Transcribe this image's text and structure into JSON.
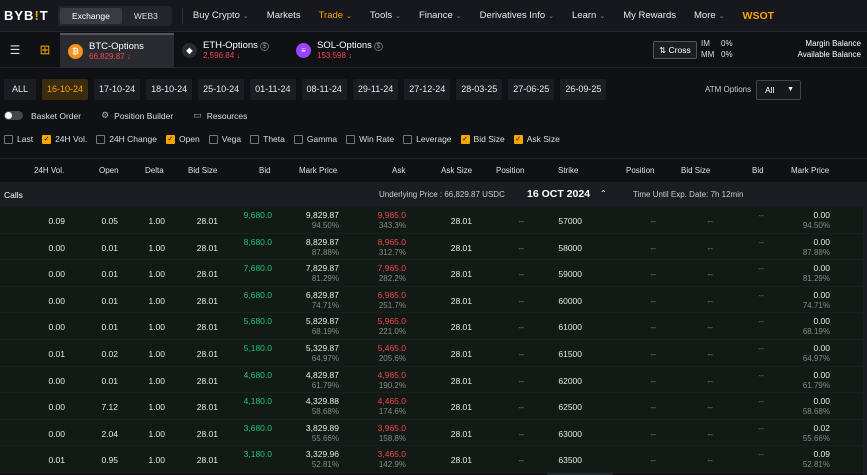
{
  "logo": {
    "text": "BYB",
    "accent": "!",
    "text2": "T"
  },
  "topnav": {
    "seg": [
      "Exchange",
      "WEB3"
    ],
    "items": [
      {
        "label": "Buy Crypto",
        "chev": true
      },
      {
        "label": "Markets",
        "chev": false
      },
      {
        "label": "Trade",
        "chev": true,
        "active": true
      },
      {
        "label": "Tools",
        "chev": true
      },
      {
        "label": "Finance",
        "chev": true
      },
      {
        "label": "Derivatives Info",
        "chev": true
      },
      {
        "label": "Learn",
        "chev": true
      },
      {
        "label": "My Rewards",
        "chev": false
      },
      {
        "label": "More",
        "chev": true
      }
    ],
    "promo": "WSOT"
  },
  "assets": [
    {
      "name": "BTC-Options",
      "price": "66,829.87 ↓",
      "color": "#f7931a",
      "glyph": "₿"
    },
    {
      "name": "ETH-Options",
      "price": "2,596.84 ↓",
      "color": "#2a2b31",
      "glyph": "◆"
    },
    {
      "name": "SOL-Options",
      "price": "153.598 ↓",
      "color": "#9945ff",
      "glyph": "≡"
    }
  ],
  "account": {
    "cross": "Cross",
    "im_label": "IM",
    "im_value": "0%",
    "mm_label": "MM",
    "mm_value": "0%",
    "margin": "Margin Balance",
    "available": "Available Balance"
  },
  "dates": {
    "all": "ALL",
    "items": [
      "16-10-24",
      "17-10-24",
      "18-10-24",
      "25-10-24",
      "01-11-24",
      "08-11-24",
      "29-11-24",
      "27-12-24",
      "28-03-25",
      "27-06-25",
      "26-09-25"
    ],
    "selected": 0
  },
  "atm": {
    "label": "ATM Options",
    "value": "All"
  },
  "tools": {
    "basket": "Basket Order",
    "builder": "Position Builder",
    "resources": "Resources"
  },
  "checks": [
    {
      "label": "Last",
      "on": false
    },
    {
      "label": "24H Vol.",
      "on": true
    },
    {
      "label": "24H Change",
      "on": false
    },
    {
      "label": "Open",
      "on": true
    },
    {
      "label": "Vega",
      "on": false
    },
    {
      "label": "Theta",
      "on": false
    },
    {
      "label": "Gamma",
      "on": false
    },
    {
      "label": "Win Rate",
      "on": false
    },
    {
      "label": "Leverage",
      "on": false
    },
    {
      "label": "Bid Size",
      "on": true
    },
    {
      "label": "Ask Size",
      "on": true
    }
  ],
  "headers": {
    "vol": "24H Vol.",
    "open": "Open",
    "delta": "Delta",
    "bidsize": "Bid Size",
    "bid": "Bid",
    "mark": "Mark Price",
    "ask": "Ask",
    "asksize": "Ask Size",
    "position": "Position",
    "strike": "Strike",
    "position2": "Position",
    "bidsize2": "Bid Size",
    "bid2": "Bid",
    "mark2": "Mark Price"
  },
  "calls": {
    "label": "Calls",
    "underlying": "Underlying Price : 66,829.87 USDC",
    "expiry": "16 OCT 2024",
    "time": "Time Until Exp. Date:  7h 12min"
  },
  "rows": [
    {
      "vol": "0.09",
      "open": "0.05",
      "delta": "1.00",
      "bidsize": "28.01",
      "bid": "9,680.0",
      "mark": "9,829.87",
      "markpct": "94.50%",
      "ask": "9,965.0",
      "askpct": "343.3%",
      "asksize": "28.01",
      "pos": "--",
      "strike": "57000",
      "pos2": "--",
      "bidsize2": "--",
      "bid2": "--",
      "mark2": "0.00",
      "mark2pct": "94.50%"
    },
    {
      "vol": "0.00",
      "open": "0.01",
      "delta": "1.00",
      "bidsize": "28.01",
      "bid": "8,680.0",
      "mark": "8,829.87",
      "markpct": "87.88%",
      "ask": "8,965.0",
      "askpct": "312.7%",
      "asksize": "28.01",
      "pos": "--",
      "strike": "58000",
      "pos2": "--",
      "bidsize2": "--",
      "bid2": "--",
      "mark2": "0.00",
      "mark2pct": "87.88%"
    },
    {
      "vol": "0.00",
      "open": "0.01",
      "delta": "1.00",
      "bidsize": "28.01",
      "bid": "7,680.0",
      "mark": "7,829.87",
      "markpct": "81.29%",
      "ask": "7,965.0",
      "askpct": "282.2%",
      "asksize": "28.01",
      "pos": "--",
      "strike": "59000",
      "pos2": "--",
      "bidsize2": "--",
      "bid2": "--",
      "mark2": "0.00",
      "mark2pct": "81.29%"
    },
    {
      "vol": "0.00",
      "open": "0.01",
      "delta": "1.00",
      "bidsize": "28.01",
      "bid": "6,680.0",
      "mark": "6,829.87",
      "markpct": "74.71%",
      "ask": "6,965.0",
      "askpct": "251.7%",
      "asksize": "28.01",
      "pos": "--",
      "strike": "60000",
      "pos2": "--",
      "bidsize2": "--",
      "bid2": "--",
      "mark2": "0.00",
      "mark2pct": "74.71%"
    },
    {
      "vol": "0.00",
      "open": "0.01",
      "delta": "1.00",
      "bidsize": "28.01",
      "bid": "5,680.0",
      "mark": "5,829.87",
      "markpct": "68.19%",
      "ask": "5,965.0",
      "askpct": "221.0%",
      "asksize": "28.01",
      "pos": "--",
      "strike": "61000",
      "pos2": "--",
      "bidsize2": "--",
      "bid2": "--",
      "mark2": "0.00",
      "mark2pct": "68.19%"
    },
    {
      "vol": "0.01",
      "open": "0.02",
      "delta": "1.00",
      "bidsize": "28.01",
      "bid": "5,180.0",
      "mark": "5,329.87",
      "markpct": "64.97%",
      "ask": "5,465.0",
      "askpct": "205.6%",
      "asksize": "28.01",
      "pos": "--",
      "strike": "61500",
      "pos2": "--",
      "bidsize2": "--",
      "bid2": "--",
      "mark2": "0.00",
      "mark2pct": "64.97%"
    },
    {
      "vol": "0.00",
      "open": "0.01",
      "delta": "1.00",
      "bidsize": "28.01",
      "bid": "4,680.0",
      "mark": "4,829.87",
      "markpct": "61.79%",
      "ask": "4,965.0",
      "askpct": "190.2%",
      "asksize": "28.01",
      "pos": "--",
      "strike": "62000",
      "pos2": "--",
      "bidsize2": "--",
      "bid2": "--",
      "mark2": "0.00",
      "mark2pct": "61.79%"
    },
    {
      "vol": "0.00",
      "open": "7.12",
      "delta": "1.00",
      "bidsize": "28.01",
      "bid": "4,180.0",
      "mark": "4,329.88",
      "markpct": "58.68%",
      "ask": "4,465.0",
      "askpct": "174.6%",
      "asksize": "28.01",
      "pos": "--",
      "strike": "62500",
      "pos2": "--",
      "bidsize2": "--",
      "bid2": "--",
      "mark2": "0.00",
      "mark2pct": "58.68%"
    },
    {
      "vol": "0.00",
      "open": "2.04",
      "delta": "1.00",
      "bidsize": "28.01",
      "bid": "3,680.0",
      "mark": "3,829.89",
      "markpct": "55.66%",
      "ask": "3,965.0",
      "askpct": "158.8%",
      "asksize": "28.01",
      "pos": "--",
      "strike": "63000",
      "pos2": "--",
      "bidsize2": "--",
      "bid2": "--",
      "mark2": "0.02",
      "mark2pct": "55.66%"
    },
    {
      "vol": "0.01",
      "open": "0.95",
      "delta": "1.00",
      "bidsize": "28.01",
      "bid": "3,180.0",
      "mark": "3,329.96",
      "markpct": "52.81%",
      "ask": "3,465.0",
      "askpct": "142.9%",
      "asksize": "28.01",
      "pos": "--",
      "strike": "63500",
      "pos2": "--",
      "bidsize2": "--",
      "bid2": "--",
      "mark2": "0.09",
      "mark2pct": "52.81%"
    }
  ]
}
